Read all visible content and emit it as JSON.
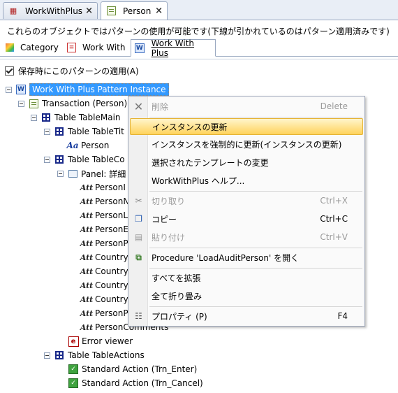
{
  "tabs": [
    {
      "label": "WorkWithPlus",
      "icon": "wwp-object-icon",
      "active": false
    },
    {
      "label": "Person",
      "icon": "transaction-icon",
      "active": true
    }
  ],
  "description": "これらのオブジェクトではパターンの使用が可能です(下線が引かれているのはパターン適用済みです)",
  "pattern_tabs": [
    {
      "label": "Category",
      "active": false,
      "underlined": false
    },
    {
      "label": "Work With",
      "active": false,
      "underlined": false
    },
    {
      "label": "Work With Plus",
      "active": true,
      "underlined": true
    }
  ],
  "apply_on_save": {
    "label": "保存時にこのパターンの適用(A)",
    "checked": true
  },
  "tree": {
    "root": "Work With Plus Pattern Instance",
    "transaction": "Transaction (Person)",
    "table_main": "Table TableMain",
    "table_title": "Table TableTit",
    "person_text": "Person",
    "table_content": "Table TableCo",
    "panel": "Panel: 詳細",
    "attributes": [
      "PersonI",
      "PersonN",
      "PersonL",
      "PersonE",
      "PersonP",
      "Country",
      "Country",
      "Country",
      "Country",
      "PersonP",
      "PersonComments"
    ],
    "error_viewer": "Error viewer",
    "table_actions": "Table TableActions",
    "actions": [
      "Standard Action (Trn_Enter)",
      "Standard Action (Trn_Cancel)"
    ]
  },
  "context_menu": {
    "delete": {
      "label": "削除",
      "shortcut": "Delete"
    },
    "update_instance": "インスタンスの更新",
    "force_update": "インスタンスを強制的に更新(インスタンスの更新)",
    "change_template": "選択されたテンプレートの変更",
    "help": "WorkWithPlus ヘルプ...",
    "cut": {
      "label": "切り取り",
      "shortcut": "Ctrl+X"
    },
    "copy": {
      "label": "コピー",
      "shortcut": "Ctrl+C"
    },
    "paste": {
      "label": "貼り付け",
      "shortcut": "Ctrl+V"
    },
    "open_procedure": "Procedure 'LoadAuditPerson' を開く",
    "expand_all": "すべてを拡張",
    "collapse_all": "全て折り畳み",
    "properties": {
      "label": "プロパティ (P)",
      "shortcut": "F4"
    }
  },
  "colors": {
    "selection": "#3399ff",
    "highlight": "#ffd35c",
    "tab_border": "#9aa9c1"
  }
}
